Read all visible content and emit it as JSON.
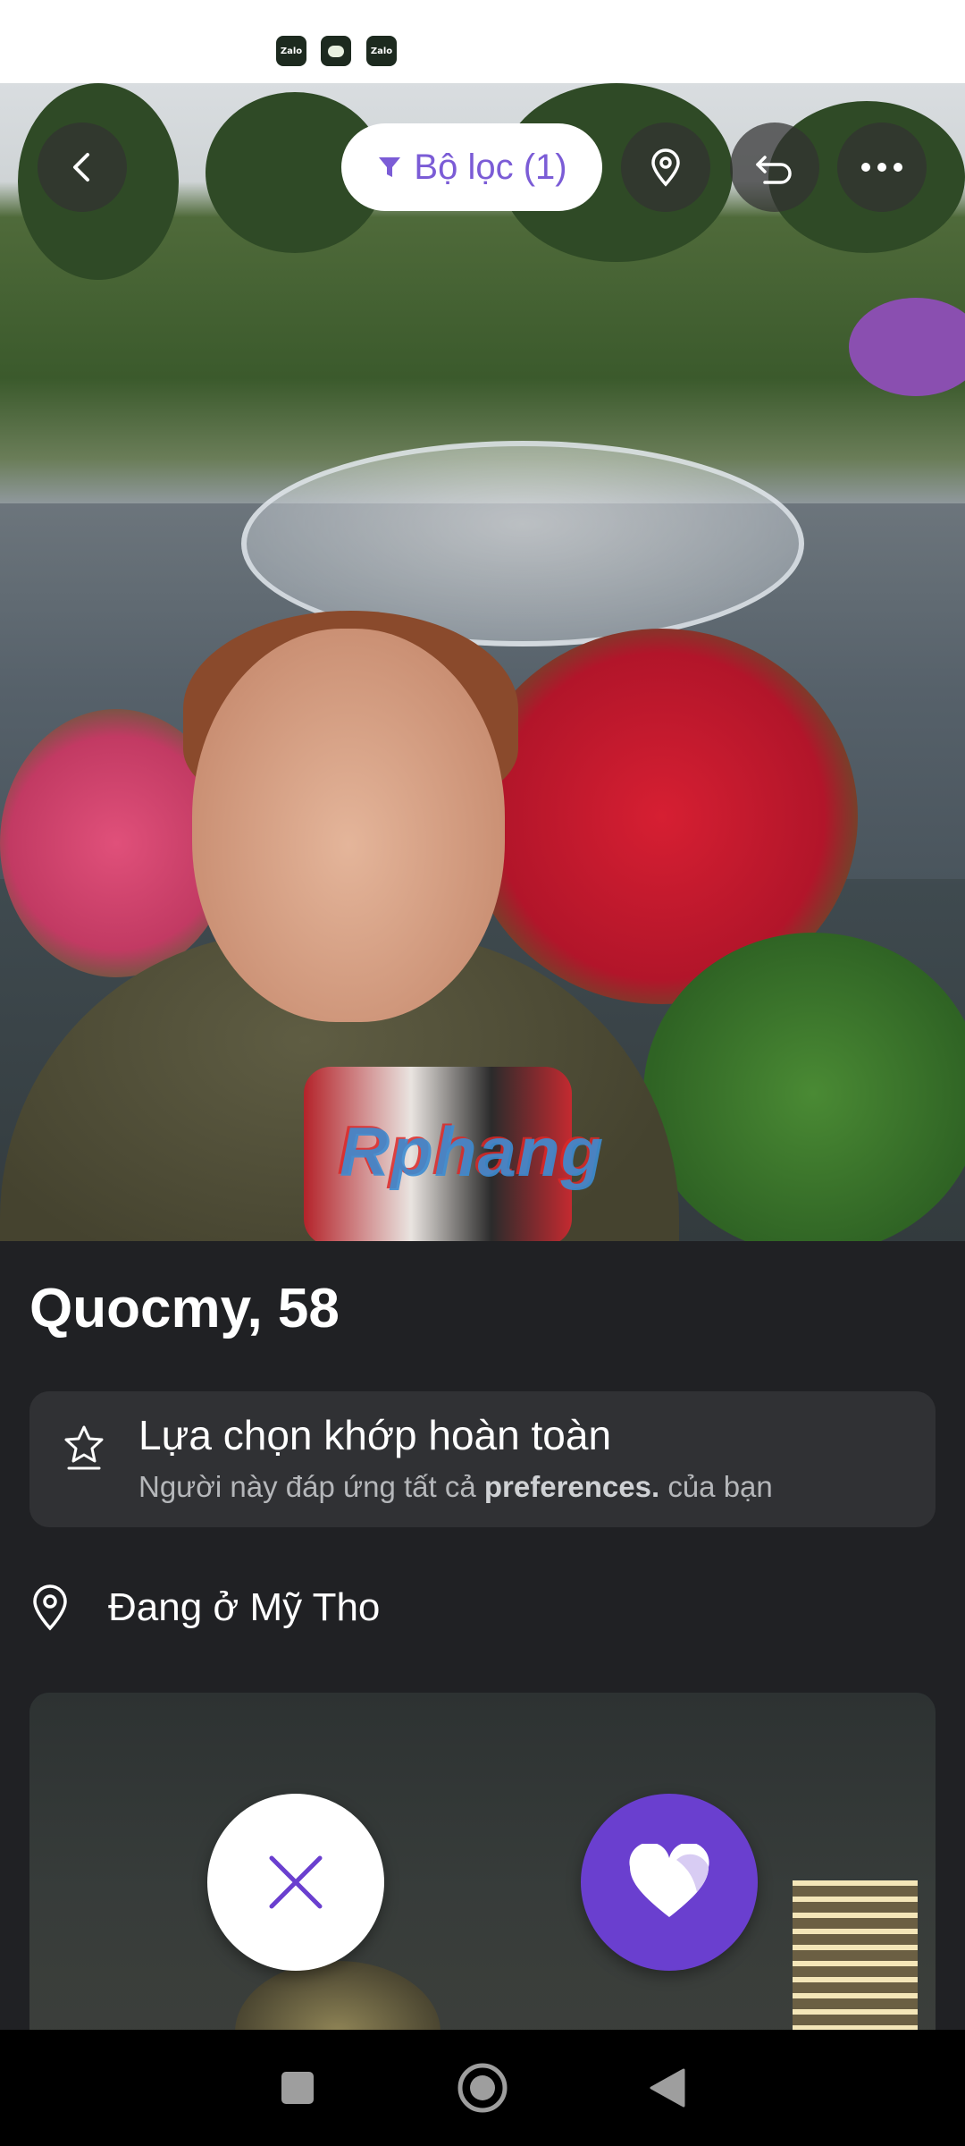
{
  "status_bar": {
    "notifications": [
      {
        "icon": "zalo-icon",
        "text": "Zalo"
      },
      {
        "icon": "message-icon",
        "text": ""
      },
      {
        "icon": "zalo-icon",
        "text": "Zalo"
      }
    ]
  },
  "top_bar": {
    "back_icon": "chevron-left-icon",
    "filter_label": "Bộ lọc (1)",
    "filter_icon": "funnel-icon",
    "location_icon": "map-pin-icon",
    "undo_icon": "undo-icon",
    "more_icon": "more-horizontal-icon"
  },
  "hero": {
    "watermark": "Rphang"
  },
  "profile": {
    "name_age": "Quocmy, 58",
    "match": {
      "icon": "star-badge-icon",
      "title": "Lựa chọn khớp hoàn toàn",
      "subtitle_pre": "Người này đáp ứng tất cả ",
      "subtitle_bold": "preferences.",
      "subtitle_post": " của bạn"
    },
    "location": {
      "icon": "map-pin-icon",
      "text": "Đang ở Mỹ Tho"
    }
  },
  "actions": {
    "pass_icon": "close-icon",
    "like_icon": "heart-icon",
    "accent_color": "#6a3fcf"
  },
  "nav_bar": {
    "recents_icon": "square-icon",
    "home_icon": "circle-icon",
    "back_icon": "triangle-back-icon"
  }
}
